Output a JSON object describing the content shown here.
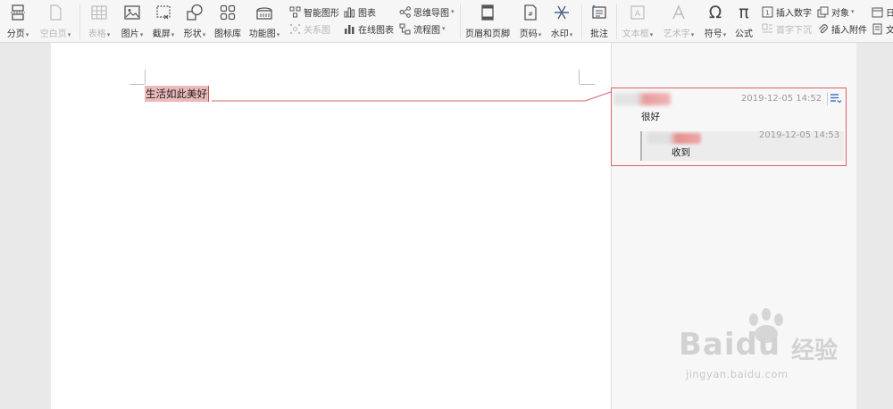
{
  "ribbon": {
    "tools": [
      {
        "id": "page",
        "label": "分页",
        "arrow": true,
        "disabled": false
      },
      {
        "id": "blank",
        "label": "空白页",
        "arrow": true,
        "disabled": true
      },
      {
        "id": "table",
        "label": "表格",
        "arrow": true,
        "disabled": true
      },
      {
        "id": "image",
        "label": "图片",
        "arrow": true,
        "disabled": false
      },
      {
        "id": "screenshot",
        "label": "截屏",
        "arrow": true,
        "disabled": false
      },
      {
        "id": "shape",
        "label": "形状",
        "arrow": true,
        "disabled": false
      },
      {
        "id": "iconlib",
        "label": "图标库",
        "arrow": false,
        "disabled": false
      },
      {
        "id": "funcchart",
        "label": "功能图",
        "arrow": true,
        "disabled": false
      },
      {
        "id": "headerfooter",
        "label": "页眉和页脚",
        "arrow": false,
        "disabled": false
      },
      {
        "id": "pagenum",
        "label": "页码",
        "arrow": true,
        "disabled": false
      },
      {
        "id": "watermark",
        "label": "水印",
        "arrow": true,
        "disabled": false
      },
      {
        "id": "comment",
        "label": "批注",
        "arrow": false,
        "disabled": false
      },
      {
        "id": "textbox",
        "label": "文本框",
        "arrow": true,
        "disabled": true
      },
      {
        "id": "wordart",
        "label": "艺术字",
        "arrow": true,
        "disabled": true
      },
      {
        "id": "symbol",
        "label": "符号",
        "arrow": true,
        "disabled": false
      },
      {
        "id": "formula",
        "label": "公式",
        "arrow": false,
        "disabled": false
      }
    ],
    "small": {
      "smart_graphic": "智能图形",
      "relation": "关系图",
      "chart": "图表",
      "online_chart": "在线图表",
      "mindmap": "思维导图",
      "flowchart": "流程图",
      "insert_number": "插入数字",
      "dropcap": "首字下沉",
      "object": "对象",
      "attachment": "插入附件",
      "date": "日",
      "doc": "文"
    }
  },
  "document": {
    "text": "生活如此美好"
  },
  "comments": {
    "main_time": "2019-12-05 14:52",
    "main_text": "很好",
    "reply_time": "2019-12-05 14:53",
    "reply_text": "收到"
  },
  "watermark": {
    "brand": "Bai",
    "brand2": "du",
    "cn": "经验",
    "url": "jingyan.baidu.com"
  },
  "colors": {
    "highlight": "#ebb9b9",
    "comment_border": "#d9636a"
  }
}
